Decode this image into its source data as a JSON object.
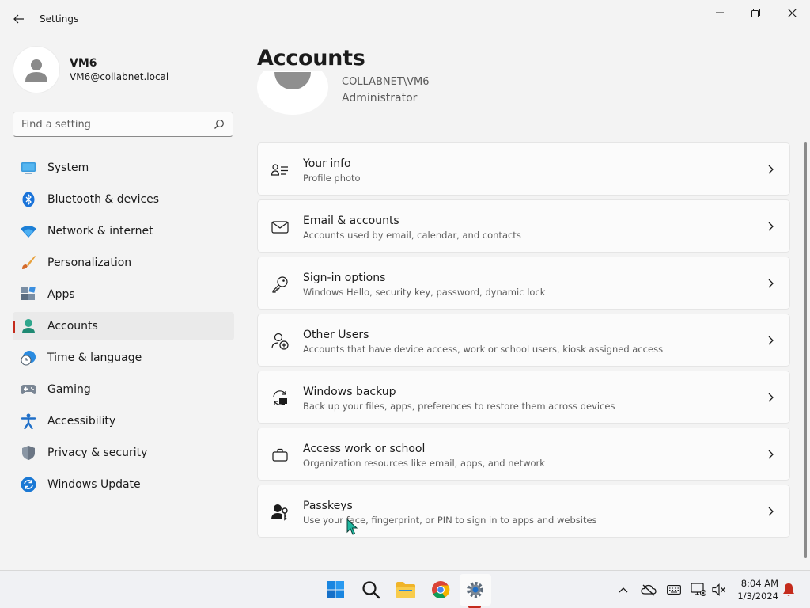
{
  "window": {
    "title": "Settings"
  },
  "profile": {
    "name": "VM6",
    "email": "VM6@collabnet.local"
  },
  "search": {
    "placeholder": "Find a setting"
  },
  "nav": {
    "items": [
      {
        "label": "System",
        "icon": "system-icon"
      },
      {
        "label": "Bluetooth & devices",
        "icon": "bluetooth-icon"
      },
      {
        "label": "Network & internet",
        "icon": "wifi-icon"
      },
      {
        "label": "Personalization",
        "icon": "paintbrush-icon"
      },
      {
        "label": "Apps",
        "icon": "apps-icon"
      },
      {
        "label": "Accounts",
        "icon": "accounts-icon",
        "selected": true
      },
      {
        "label": "Time & language",
        "icon": "globe-clock-icon"
      },
      {
        "label": "Gaming",
        "icon": "gamepad-icon"
      },
      {
        "label": "Accessibility",
        "icon": "accessibility-icon"
      },
      {
        "label": "Privacy & security",
        "icon": "shield-icon"
      },
      {
        "label": "Windows Update",
        "icon": "update-icon"
      }
    ]
  },
  "page": {
    "title": "Accounts",
    "account_line1": "COLLABNET\\VM6",
    "account_role": "Administrator"
  },
  "cards": [
    {
      "title": "Your info",
      "subtitle": "Profile photo",
      "icon": "person-info-icon"
    },
    {
      "title": "Email & accounts",
      "subtitle": "Accounts used by email, calendar, and contacts",
      "icon": "mail-icon"
    },
    {
      "title": "Sign-in options",
      "subtitle": "Windows Hello, security key, password, dynamic lock",
      "icon": "key-icon"
    },
    {
      "title": "Other Users",
      "subtitle": "Accounts that have device access, work or school users, kiosk assigned access",
      "icon": "add-person-icon"
    },
    {
      "title": "Windows backup",
      "subtitle": "Back up your files, apps, preferences to restore them across devices",
      "icon": "backup-icon"
    },
    {
      "title": "Access work or school",
      "subtitle": "Organization resources like email, apps, and network",
      "icon": "briefcase-icon"
    },
    {
      "title": "Passkeys",
      "subtitle": "Use your face, fingerprint, or PIN to sign in to apps and websites",
      "icon": "passkey-icon"
    }
  ],
  "taskbar": {
    "apps": [
      "start-icon",
      "search-icon",
      "file-explorer-icon",
      "chrome-icon",
      "settings-icon"
    ],
    "clock": {
      "time": "8:04 AM",
      "date": "1/3/2024"
    }
  },
  "colors": {
    "accent": "#c42b1c",
    "link_blue": "#0067c0"
  }
}
